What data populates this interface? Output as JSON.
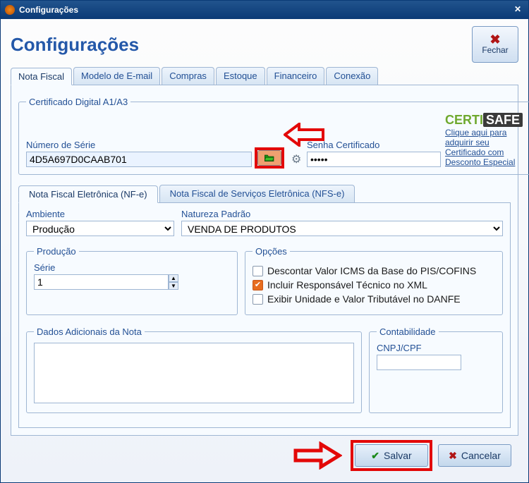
{
  "window_title": "Configurações",
  "page_title": "Configurações",
  "close_button_label": "Fechar",
  "tabs": [
    {
      "label": "Nota Fiscal",
      "active": true
    },
    {
      "label": "Modelo de E-mail"
    },
    {
      "label": "Compras"
    },
    {
      "label": "Estoque"
    },
    {
      "label": "Financeiro"
    },
    {
      "label": "Conexão"
    }
  ],
  "cert_group_title": "Certificado Digital A1/A3",
  "cert_serial_label": "Número de Série",
  "cert_serial_value": "4D5A697D0CAAB701",
  "cert_password_label": "Senha Certificado",
  "cert_password_value": "•••••",
  "certsafe_link_line1": "Clique aqui para adquirir seu",
  "certsafe_link_line2": "Certificado com Desconto Especial",
  "subtabs": [
    {
      "label": "Nota Fiscal Eletrônica (NF-e)",
      "active": true
    },
    {
      "label": "Nota Fiscal de Serviços Eletrônica (NFS-e)"
    }
  ],
  "ambiente_label": "Ambiente",
  "ambiente_value": "Produção",
  "natureza_label": "Natureza Padrão",
  "natureza_value": "VENDA DE PRODUTOS",
  "producao_group": "Produção",
  "serie_label": "Série",
  "serie_value": "1",
  "opcoes_group": "Opções",
  "opcoes": [
    {
      "label": "Descontar Valor ICMS da Base do PIS/COFINS",
      "checked": false
    },
    {
      "label": "Incluir Responsável Técnico no XML",
      "checked": true
    },
    {
      "label": "Exibir Unidade e Valor Tributável no DANFE",
      "checked": false
    }
  ],
  "dados_group": "Dados Adicionais da Nota",
  "dados_value": "",
  "contab_group": "Contabilidade",
  "cnpjcpf_label": "CNPJ/CPF",
  "cnpjcpf_value": "",
  "save_label": "Salvar",
  "cancel_label": "Cancelar"
}
